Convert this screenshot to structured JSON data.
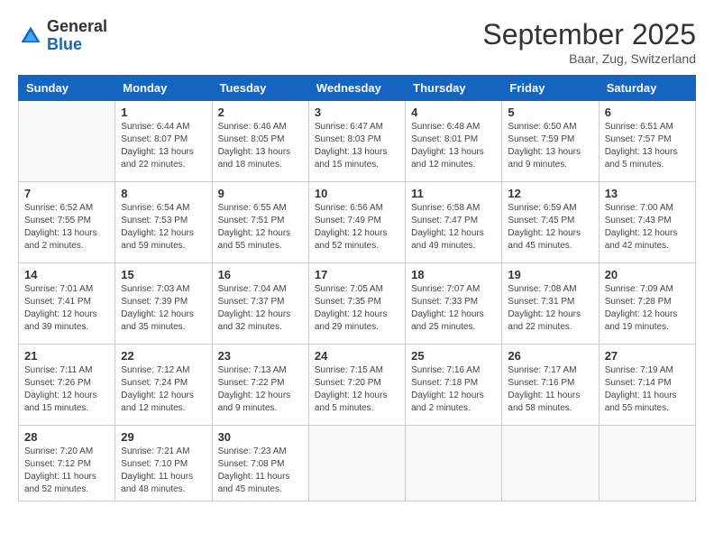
{
  "header": {
    "logo_general": "General",
    "logo_blue": "Blue",
    "month_title": "September 2025",
    "location": "Baar, Zug, Switzerland"
  },
  "days_of_week": [
    "Sunday",
    "Monday",
    "Tuesday",
    "Wednesday",
    "Thursday",
    "Friday",
    "Saturday"
  ],
  "weeks": [
    [
      {
        "day": "",
        "content": ""
      },
      {
        "day": "1",
        "content": "Sunrise: 6:44 AM\nSunset: 8:07 PM\nDaylight: 13 hours\nand 22 minutes."
      },
      {
        "day": "2",
        "content": "Sunrise: 6:46 AM\nSunset: 8:05 PM\nDaylight: 13 hours\nand 18 minutes."
      },
      {
        "day": "3",
        "content": "Sunrise: 6:47 AM\nSunset: 8:03 PM\nDaylight: 13 hours\nand 15 minutes."
      },
      {
        "day": "4",
        "content": "Sunrise: 6:48 AM\nSunset: 8:01 PM\nDaylight: 13 hours\nand 12 minutes."
      },
      {
        "day": "5",
        "content": "Sunrise: 6:50 AM\nSunset: 7:59 PM\nDaylight: 13 hours\nand 9 minutes."
      },
      {
        "day": "6",
        "content": "Sunrise: 6:51 AM\nSunset: 7:57 PM\nDaylight: 13 hours\nand 5 minutes."
      }
    ],
    [
      {
        "day": "7",
        "content": "Sunrise: 6:52 AM\nSunset: 7:55 PM\nDaylight: 13 hours\nand 2 minutes."
      },
      {
        "day": "8",
        "content": "Sunrise: 6:54 AM\nSunset: 7:53 PM\nDaylight: 12 hours\nand 59 minutes."
      },
      {
        "day": "9",
        "content": "Sunrise: 6:55 AM\nSunset: 7:51 PM\nDaylight: 12 hours\nand 55 minutes."
      },
      {
        "day": "10",
        "content": "Sunrise: 6:56 AM\nSunset: 7:49 PM\nDaylight: 12 hours\nand 52 minutes."
      },
      {
        "day": "11",
        "content": "Sunrise: 6:58 AM\nSunset: 7:47 PM\nDaylight: 12 hours\nand 49 minutes."
      },
      {
        "day": "12",
        "content": "Sunrise: 6:59 AM\nSunset: 7:45 PM\nDaylight: 12 hours\nand 45 minutes."
      },
      {
        "day": "13",
        "content": "Sunrise: 7:00 AM\nSunset: 7:43 PM\nDaylight: 12 hours\nand 42 minutes."
      }
    ],
    [
      {
        "day": "14",
        "content": "Sunrise: 7:01 AM\nSunset: 7:41 PM\nDaylight: 12 hours\nand 39 minutes."
      },
      {
        "day": "15",
        "content": "Sunrise: 7:03 AM\nSunset: 7:39 PM\nDaylight: 12 hours\nand 35 minutes."
      },
      {
        "day": "16",
        "content": "Sunrise: 7:04 AM\nSunset: 7:37 PM\nDaylight: 12 hours\nand 32 minutes."
      },
      {
        "day": "17",
        "content": "Sunrise: 7:05 AM\nSunset: 7:35 PM\nDaylight: 12 hours\nand 29 minutes."
      },
      {
        "day": "18",
        "content": "Sunrise: 7:07 AM\nSunset: 7:33 PM\nDaylight: 12 hours\nand 25 minutes."
      },
      {
        "day": "19",
        "content": "Sunrise: 7:08 AM\nSunset: 7:31 PM\nDaylight: 12 hours\nand 22 minutes."
      },
      {
        "day": "20",
        "content": "Sunrise: 7:09 AM\nSunset: 7:28 PM\nDaylight: 12 hours\nand 19 minutes."
      }
    ],
    [
      {
        "day": "21",
        "content": "Sunrise: 7:11 AM\nSunset: 7:26 PM\nDaylight: 12 hours\nand 15 minutes."
      },
      {
        "day": "22",
        "content": "Sunrise: 7:12 AM\nSunset: 7:24 PM\nDaylight: 12 hours\nand 12 minutes."
      },
      {
        "day": "23",
        "content": "Sunrise: 7:13 AM\nSunset: 7:22 PM\nDaylight: 12 hours\nand 9 minutes."
      },
      {
        "day": "24",
        "content": "Sunrise: 7:15 AM\nSunset: 7:20 PM\nDaylight: 12 hours\nand 5 minutes."
      },
      {
        "day": "25",
        "content": "Sunrise: 7:16 AM\nSunset: 7:18 PM\nDaylight: 12 hours\nand 2 minutes."
      },
      {
        "day": "26",
        "content": "Sunrise: 7:17 AM\nSunset: 7:16 PM\nDaylight: 11 hours\nand 58 minutes."
      },
      {
        "day": "27",
        "content": "Sunrise: 7:19 AM\nSunset: 7:14 PM\nDaylight: 11 hours\nand 55 minutes."
      }
    ],
    [
      {
        "day": "28",
        "content": "Sunrise: 7:20 AM\nSunset: 7:12 PM\nDaylight: 11 hours\nand 52 minutes."
      },
      {
        "day": "29",
        "content": "Sunrise: 7:21 AM\nSunset: 7:10 PM\nDaylight: 11 hours\nand 48 minutes."
      },
      {
        "day": "30",
        "content": "Sunrise: 7:23 AM\nSunset: 7:08 PM\nDaylight: 11 hours\nand 45 minutes."
      },
      {
        "day": "",
        "content": ""
      },
      {
        "day": "",
        "content": ""
      },
      {
        "day": "",
        "content": ""
      },
      {
        "day": "",
        "content": ""
      }
    ]
  ]
}
